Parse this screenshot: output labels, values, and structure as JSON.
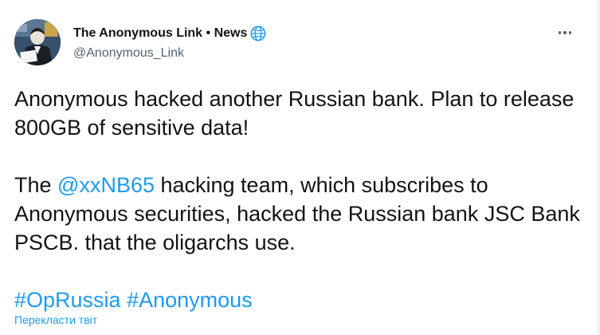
{
  "author": {
    "display_name": "The Anonymous Link • News",
    "handle": "@Anonymous_Link",
    "verified_icon": "globe-icon"
  },
  "tweet": {
    "line1": "Anonymous hacked another Russian bank. Plan to release 800GB of sensitive data!",
    "p2_before": "The ",
    "mention": "@xxNB65",
    "p2_after": " hacking team, which subscribes to Anonymous securities, hacked the Russian bank JSC Bank PSCB. that the oligarchs use.",
    "hashtag1": "#OpRussia",
    "hashtag2": "#Anonymous"
  },
  "translate_label": "Перекласти твіт",
  "more_icon": "more-horizontal-icon",
  "colors": {
    "link": "#1d9bf0",
    "text": "#0f1419",
    "secondary": "#536471"
  }
}
